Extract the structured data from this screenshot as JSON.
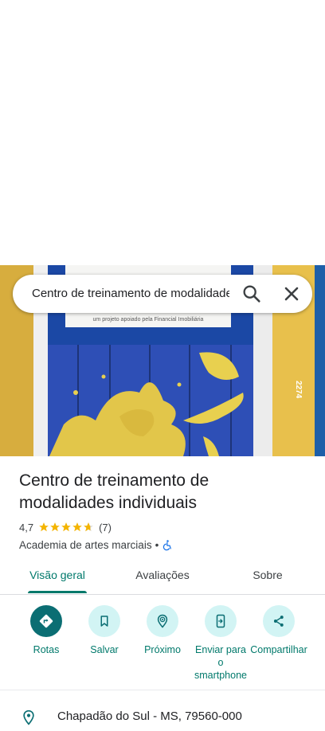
{
  "search": {
    "query": "Centro de treinamento de modalidades individuais"
  },
  "photo": {
    "banner_text": "um projeto apoiado pela Financial Imobiliária",
    "street_number": "2274"
  },
  "place": {
    "title_line1": "Centro de treinamento de",
    "title_line2": "modalidades individuais",
    "rating": "4,7",
    "stars": 4.7,
    "review_count": "(7)",
    "category": "Academia de artes marciais",
    "separator": "•"
  },
  "tabs": [
    {
      "label": "Visão geral",
      "active": true
    },
    {
      "label": "Avaliações",
      "active": false
    },
    {
      "label": "Sobre",
      "active": false
    }
  ],
  "actions": [
    {
      "label": "Rotas",
      "icon": "directions-icon"
    },
    {
      "label": "Salvar",
      "icon": "bookmark-icon"
    },
    {
      "label": "Próximo",
      "icon": "nearby-icon"
    },
    {
      "label": "Enviar para o smartphone",
      "icon": "send-to-phone-icon"
    },
    {
      "label": "Compartilhar",
      "icon": "share-icon"
    }
  ],
  "address": {
    "text": "Chapadão do Sul - MS, 79560-000"
  },
  "colors": {
    "accent": "#00796b",
    "primary_button": "#0b6e73",
    "tonal_button": "#d2f4f4",
    "star": "#f4b400"
  }
}
